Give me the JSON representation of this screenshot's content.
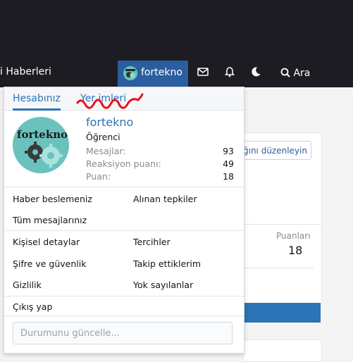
{
  "navbar": {
    "left_text": "i Haberleri",
    "username": "fortekno",
    "search_label": "Ara",
    "icons": [
      "envelope-icon",
      "bell-icon",
      "moon-icon",
      "search-icon"
    ]
  },
  "background": {
    "edit_button": "ğını düzenleyin",
    "points_label": "Puanları",
    "points_value": "18"
  },
  "menu": {
    "tabs": [
      "Hesabınız",
      "Yer imleri"
    ],
    "logo_text": "fortekno",
    "user": {
      "name": "fortekno",
      "role": "Öğrenci",
      "stats": [
        {
          "label": "Mesajlar:",
          "value": "93"
        },
        {
          "label": "Reaksiyon puanı:",
          "value": "49"
        },
        {
          "label": "Puan:",
          "value": "18"
        }
      ]
    },
    "links_group1": [
      "Haber beslemeniz",
      "Alınan tepkiler",
      "Tüm mesajlarınız"
    ],
    "links_group2": [
      "Kişisel detaylar",
      "Tercihler",
      "Şifre ve güvenlik",
      "Takip ettiklerim",
      "Gizlilik",
      "Yok sayılanlar"
    ],
    "logout": "Çıkış yap",
    "status_placeholder": "Durumunu güncelle..."
  },
  "colors": {
    "accent": "#2b74b6",
    "nav_bg": "#1c1c22",
    "active_tab_bg": "#2b5ea0",
    "annotation": "#e8101a"
  }
}
